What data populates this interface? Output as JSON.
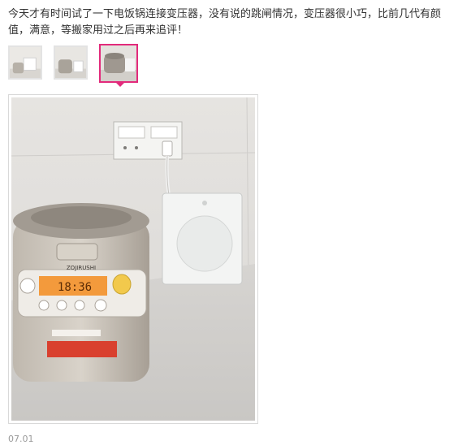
{
  "review": {
    "text": "今天才有时间试了一下电饭锅连接变压器，没有说的跳闸情况，变压器很小巧，比前几代有颜值，满意，等搬家用过之后再来追评！",
    "date": "07.01"
  },
  "thumbnails": [
    {
      "name": "thumbnail-1",
      "selected": false
    },
    {
      "name": "thumbnail-2",
      "selected": false
    },
    {
      "name": "thumbnail-3",
      "selected": true
    }
  ],
  "photo": {
    "display_time": "18:36",
    "brand": "ZOJIRUSHI"
  },
  "colors": {
    "accent": "#e22a7b",
    "text": "#333333",
    "muted": "#9a9a9a"
  }
}
